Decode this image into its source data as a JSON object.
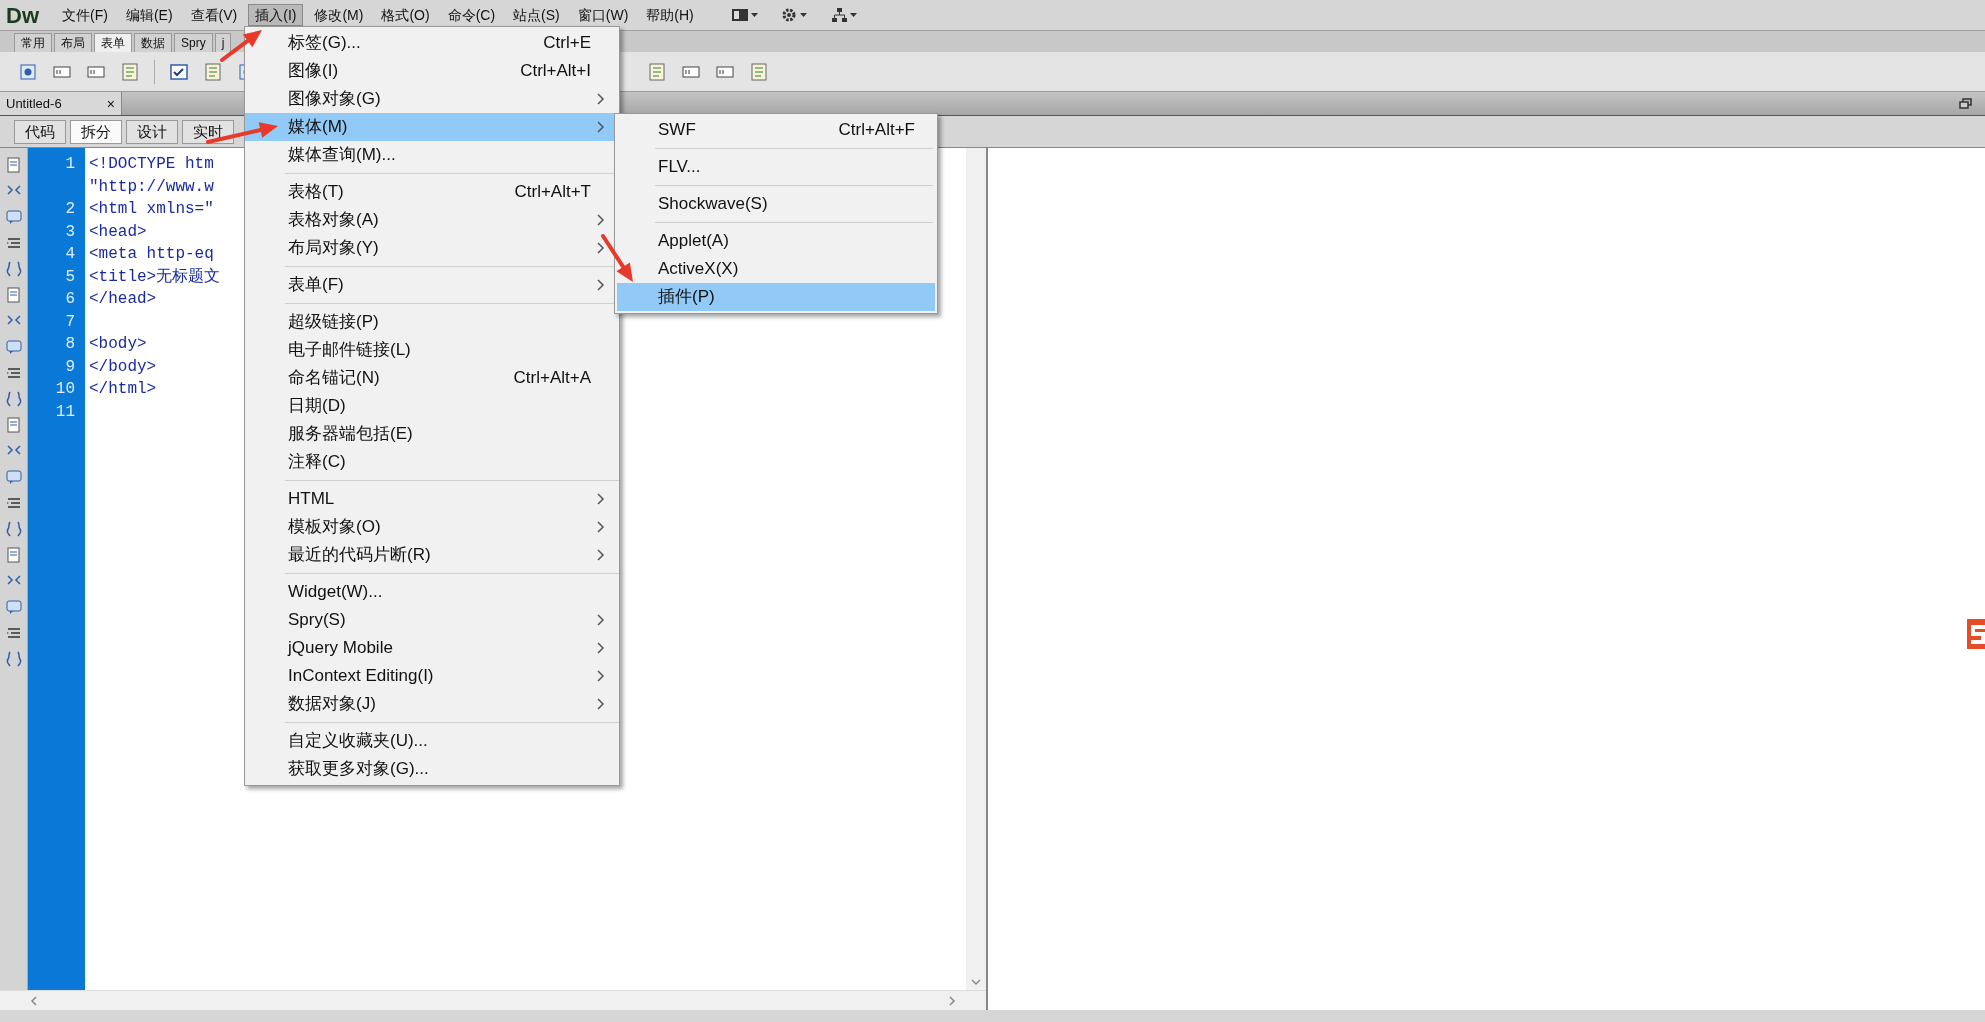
{
  "menu_bar": {
    "logo": "Dw",
    "items": [
      {
        "label": "文件(F)",
        "selected": false
      },
      {
        "label": "编辑(E)",
        "selected": false
      },
      {
        "label": "查看(V)",
        "selected": false
      },
      {
        "label": "插入(I)",
        "selected": true
      },
      {
        "label": "修改(M)",
        "selected": false
      },
      {
        "label": "格式(O)",
        "selected": false
      },
      {
        "label": "命令(C)",
        "selected": false
      },
      {
        "label": "站点(S)",
        "selected": false
      },
      {
        "label": "窗口(W)",
        "selected": false
      },
      {
        "label": "帮助(H)",
        "selected": false
      }
    ]
  },
  "insert_panel": {
    "tabs": [
      {
        "label": "常用",
        "selected": false
      },
      {
        "label": "布局",
        "selected": false
      },
      {
        "label": "表单",
        "selected": true
      },
      {
        "label": "数据",
        "selected": false
      },
      {
        "label": "Spry",
        "selected": false
      },
      {
        "label": "j",
        "selected": false
      }
    ]
  },
  "document_tab": {
    "title": "Untitled-6",
    "close": "×"
  },
  "view_buttons": [
    {
      "label": "代码",
      "selected": false
    },
    {
      "label": "拆分",
      "selected": true
    },
    {
      "label": "设计",
      "selected": false
    },
    {
      "label": "实时",
      "selected": false
    }
  ],
  "code": {
    "lines": [
      {
        "number": "1",
        "text": "<!DOCTYPE htm"
      },
      {
        "text": "\"http://www.w"
      },
      {
        "number": "2",
        "text": "<html xmlns=\""
      },
      {
        "number": "3",
        "text": "<head>"
      },
      {
        "number": "4",
        "text": "<meta http-eq"
      },
      {
        "number": "5",
        "text": "<title>无标题文"
      },
      {
        "number": "6",
        "text": "</head>"
      },
      {
        "number": "7"
      },
      {
        "number": "8",
        "text": "<body>"
      },
      {
        "number": "9",
        "text": "</body>"
      },
      {
        "number": "10",
        "text": "</html>"
      },
      {
        "number": "11"
      }
    ]
  },
  "insert_menu": {
    "items": [
      {
        "kind": "item",
        "label": "标签(G)...",
        "shortcut": "Ctrl+E",
        "submenu": false,
        "selected": false
      },
      {
        "kind": "item",
        "label": "图像(I)",
        "shortcut": "Ctrl+Alt+I",
        "submenu": false,
        "selected": false
      },
      {
        "kind": "item",
        "label": "图像对象(G)",
        "submenu": true,
        "selected": false
      },
      {
        "kind": "item",
        "label": "媒体(M)",
        "submenu": true,
        "selected": true
      },
      {
        "kind": "item",
        "label": "媒体查询(M)...",
        "submenu": false,
        "selected": false
      },
      {
        "kind": "separator"
      },
      {
        "kind": "item",
        "label": "表格(T)",
        "shortcut": "Ctrl+Alt+T",
        "submenu": false,
        "selected": false
      },
      {
        "kind": "item",
        "label": "表格对象(A)",
        "submenu": true,
        "selected": false
      },
      {
        "kind": "item",
        "label": "布局对象(Y)",
        "submenu": true,
        "selected": false
      },
      {
        "kind": "separator"
      },
      {
        "kind": "item",
        "label": "表单(F)",
        "submenu": true,
        "selected": false
      },
      {
        "kind": "separator"
      },
      {
        "kind": "item",
        "label": "超级链接(P)",
        "submenu": false,
        "selected": false
      },
      {
        "kind": "item",
        "label": "电子邮件链接(L)",
        "submenu": false,
        "selected": false
      },
      {
        "kind": "item",
        "label": "命名锚记(N)",
        "shortcut": "Ctrl+Alt+A",
        "submenu": false,
        "selected": false
      },
      {
        "kind": "item",
        "label": "日期(D)",
        "submenu": false,
        "selected": false
      },
      {
        "kind": "item",
        "label": "服务器端包括(E)",
        "submenu": false,
        "selected": false
      },
      {
        "kind": "item",
        "label": "注释(C)",
        "submenu": false,
        "selected": false
      },
      {
        "kind": "separator"
      },
      {
        "kind": "item",
        "label": "HTML",
        "submenu": true,
        "selected": false
      },
      {
        "kind": "item",
        "label": "模板对象(O)",
        "submenu": true,
        "selected": false
      },
      {
        "kind": "item",
        "label": "最近的代码片断(R)",
        "submenu": true,
        "selected": false
      },
      {
        "kind": "separator"
      },
      {
        "kind": "item",
        "label": "Widget(W)...",
        "submenu": false,
        "selected": false
      },
      {
        "kind": "item",
        "label": "Spry(S)",
        "submenu": true,
        "selected": false
      },
      {
        "kind": "item",
        "label": "jQuery Mobile",
        "submenu": true,
        "selected": false
      },
      {
        "kind": "item",
        "label": "InContext Editing(I)",
        "submenu": true,
        "selected": false
      },
      {
        "kind": "item",
        "label": "数据对象(J)",
        "submenu": true,
        "selected": false
      },
      {
        "kind": "separator"
      },
      {
        "kind": "item",
        "label": "自定义收藏夹(U)...",
        "submenu": false,
        "selected": false
      },
      {
        "kind": "item",
        "label": "获取更多对象(G)...",
        "submenu": false,
        "selected": false
      }
    ]
  },
  "media_submenu": {
    "items": [
      {
        "kind": "item",
        "label": "SWF",
        "shortcut": "Ctrl+Alt+F",
        "selected": false
      },
      {
        "kind": "separator"
      },
      {
        "kind": "item",
        "label": "FLV...",
        "selected": false
      },
      {
        "kind": "separator"
      },
      {
        "kind": "item",
        "label": "Shockwave(S)",
        "selected": false
      },
      {
        "kind": "separator"
      },
      {
        "kind": "item",
        "label": "Applet(A)",
        "selected": false
      },
      {
        "kind": "item",
        "label": "ActiveX(X)",
        "selected": false
      },
      {
        "kind": "item",
        "label": "插件(P)",
        "selected": true
      }
    ]
  }
}
